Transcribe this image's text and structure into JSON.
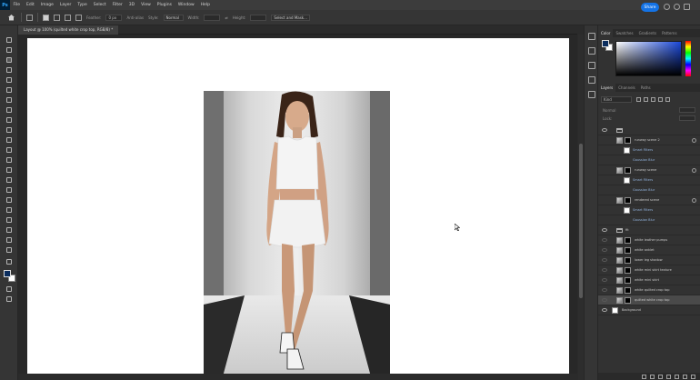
{
  "menubar": {
    "items": [
      "File",
      "Edit",
      "Image",
      "Layer",
      "Type",
      "Select",
      "Filter",
      "3D",
      "View",
      "Plugins",
      "Window",
      "Help"
    ]
  },
  "options_bar": {
    "feather_label": "Feather:",
    "feather_value": "0 px",
    "antialias_label": "Anti-alias",
    "style_label": "Style:",
    "style_value": "Normal",
    "width_label": "Width:",
    "height_label": "Height:",
    "select_mask_label": "Select and Mask...",
    "share_label": "Share"
  },
  "document": {
    "tab_label": "Layout @ 100% (quilted white crop top, RGB/8) *"
  },
  "panels": {
    "color_tabs": [
      "Color",
      "Swatches",
      "Gradients",
      "Patterns"
    ],
    "layer_tabs": [
      "Layers",
      "Channels",
      "Paths"
    ],
    "search_placeholder": "Kind",
    "blend_mode": "Normal",
    "opacity_label": "Opacity:",
    "lock_label": "Lock:",
    "fill_label": "Fill:"
  },
  "layers": [
    {
      "name": "runway scene 2",
      "kind": "group-smart"
    },
    {
      "name": "Smart Filters",
      "kind": "sub"
    },
    {
      "name": "Gaussian Blur",
      "kind": "sub"
    },
    {
      "name": "runway scene",
      "kind": "smart"
    },
    {
      "name": "Smart Filters",
      "kind": "sub"
    },
    {
      "name": "Gaussian Blur",
      "kind": "sub"
    },
    {
      "name": "rendered scene",
      "kind": "smart"
    },
    {
      "name": "Smart Filters",
      "kind": "sub"
    },
    {
      "name": "Gaussian Blur",
      "kind": "sub"
    },
    {
      "name": "fit",
      "kind": "folder"
    },
    {
      "name": "white leather pumps",
      "kind": "layer"
    },
    {
      "name": "white anklet",
      "kind": "layer"
    },
    {
      "name": "lower leg shadow",
      "kind": "layer"
    },
    {
      "name": "white mini skirt texture",
      "kind": "layer"
    },
    {
      "name": "white mini skirt",
      "kind": "layer"
    },
    {
      "name": "white quilted crop top",
      "kind": "layer"
    },
    {
      "name": "quilted white crop top",
      "kind": "layer-selected"
    },
    {
      "name": "Background",
      "kind": "background"
    }
  ],
  "colors": {
    "accent": "#1473e6",
    "foreground": "#0b2d5e",
    "background": "#ffffff",
    "ui_dark": "#323232"
  }
}
